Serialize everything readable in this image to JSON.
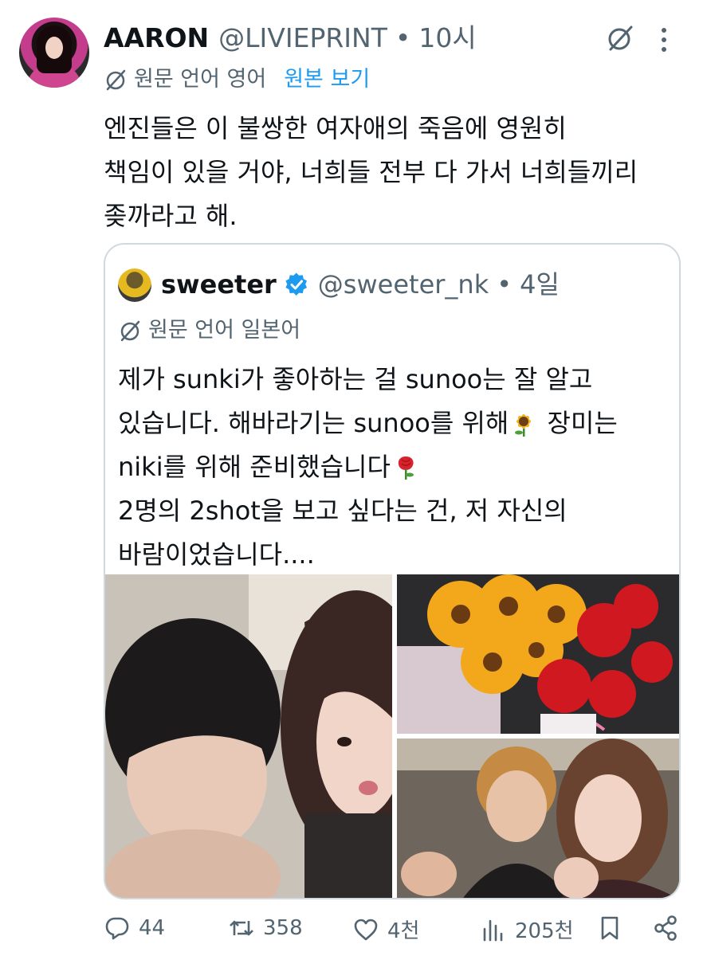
{
  "tweet": {
    "author_name": "AARON",
    "author_handle": "@LIVIEPRINT",
    "separator": "•",
    "time": "10시",
    "translation_label": "원문 언어 영어",
    "view_original": "원본 보기",
    "text_lines": [
      "엔진들은 이 불쌍한 여자애의 죽음에 영원히",
      "책임이 있을 거야, 너희들 전부 다 가서 너희들끼리",
      "좆까라고 해."
    ]
  },
  "quote": {
    "author_name": "sweeter",
    "author_handle": "@sweeter_nk",
    "separator": "•",
    "time": "4일",
    "translation_label": "원문 언어 일본어",
    "line1": "제가 sunki가 좋아하는 걸 sunoo는 잘 알고",
    "line2a": "있습니다. 해바라기는 sunoo를 위해",
    "line2b": " 장미는",
    "line3": "niki를 위해 준비했습니다",
    "line4": "2명의 2shot을 보고 싶다는 건, 저 자신의",
    "line5": "바람이었습니다...."
  },
  "actions": {
    "replies": "44",
    "retweets": "358",
    "likes": "4천",
    "views": "205천"
  },
  "icons": [
    "grok-icon",
    "more-icon",
    "globe-icon",
    "verified-badge-icon",
    "sunflower-emoji",
    "rose-emoji",
    "reply-icon",
    "retweet-icon",
    "like-icon",
    "views-icon",
    "bookmark-icon",
    "share-icon"
  ],
  "colors": {
    "link": "#1d9bf0",
    "secondary": "#536471",
    "verified": "#1d9bf0",
    "border": "#cfd9de"
  }
}
